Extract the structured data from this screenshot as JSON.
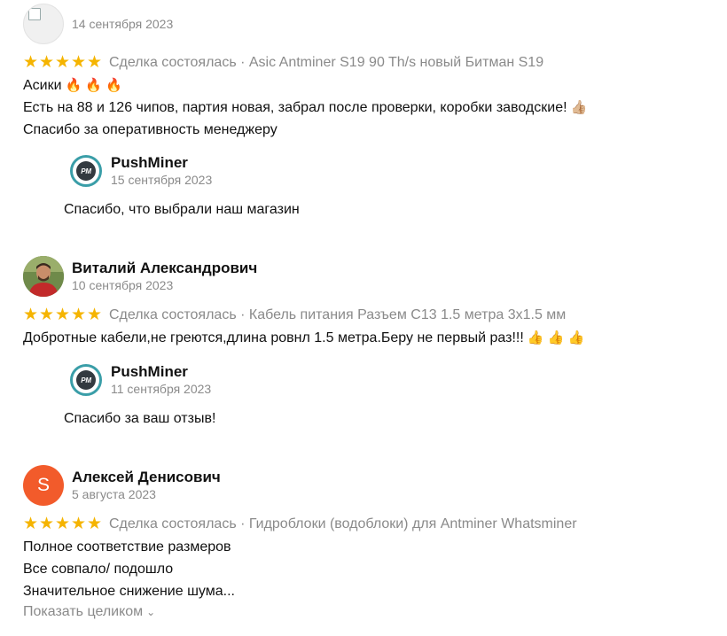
{
  "reviews": [
    {
      "date": "14 сентября 2023",
      "rating": 5,
      "deal_text": "Сделка состоялась · Asic Antminer S19 90 Th/s новый Битман S19",
      "lines": [
        "Асики",
        "Есть на 88 и 126 чипов, партия новая, забрал после проверки, коробки заводские!",
        "Спасибо за оперативность менеджеру"
      ],
      "line1_emoji": "🔥 🔥 🔥",
      "line2_emoji": "👍🏼",
      "reply": {
        "logo_text": "PM",
        "name": "PushMiner",
        "date": "15 сентября 2023",
        "text": "Спасибо, что выбрали наш магазин"
      }
    },
    {
      "name": "Виталий Александрович",
      "date": "10 сентября 2023",
      "rating": 5,
      "deal_text": "Сделка состоялась · Кабель питания Разъем C13 1.5 метра 3x1.5 мм",
      "lines": [
        "Добротные кабели,не греются,длина ровнл 1.5 метра.Беру не первый раз!!!"
      ],
      "line1_emoji": "👍 👍 👍",
      "reply": {
        "logo_text": "PM",
        "name": "PushMiner",
        "date": "11 сентября 2023",
        "text": "Спасибо за ваш отзыв!"
      }
    },
    {
      "avatar_letter": "S",
      "name": "Алексей Денисович",
      "date": "5 августа 2023",
      "rating": 5,
      "deal_text": "Сделка состоялась · Гидроблоки (водоблоки) для Antminer Whatsminer",
      "lines": [
        "Полное соответствие размеров",
        "Все совпало/ подошло",
        "Значительное снижение шума..."
      ],
      "show_more": "Показать целиком"
    }
  ],
  "colors": {
    "star": "#f5b400",
    "muted": "#8a8a8a",
    "avatar_orange": "#f25b2b",
    "logo_ring": "#3a9ea8"
  },
  "icons": {
    "star": "star-icon",
    "chevron": "chevron-down-icon",
    "fire": "fire-emoji",
    "thumb": "thumbs-up-emoji"
  }
}
